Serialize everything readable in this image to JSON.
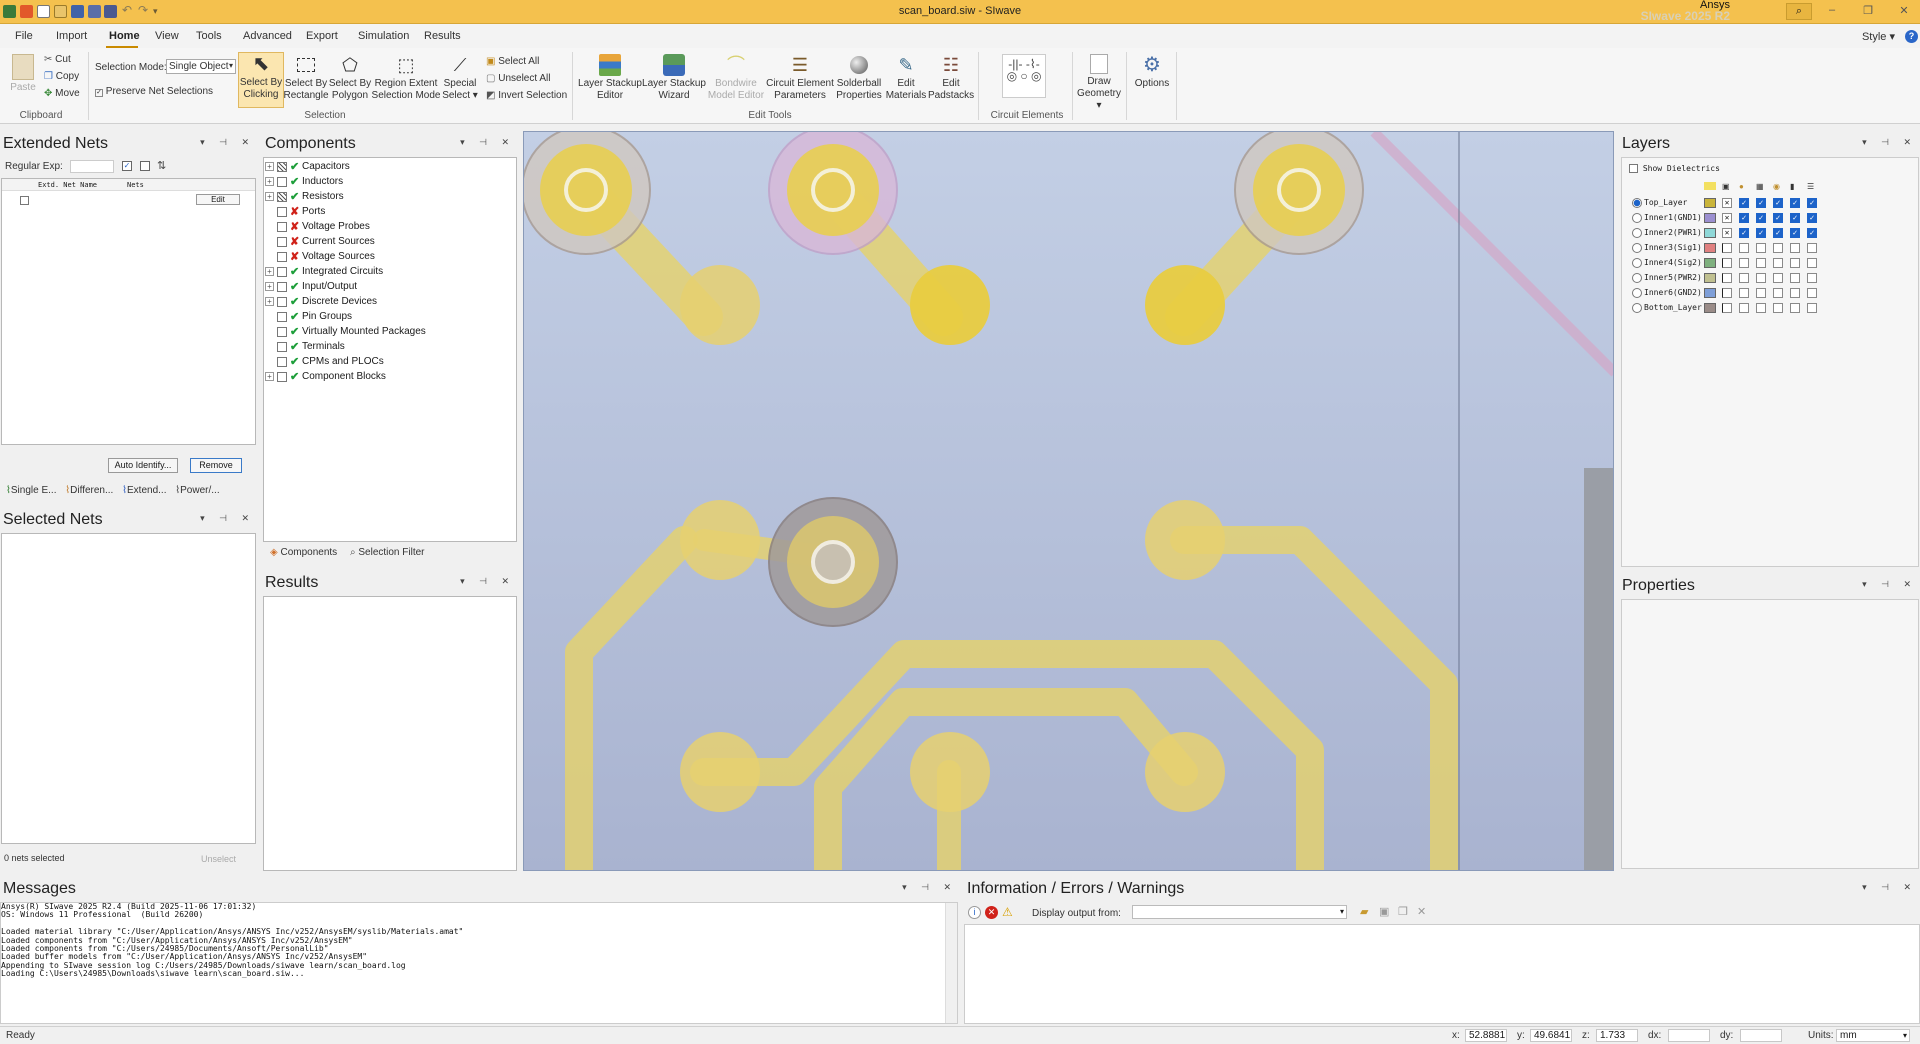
{
  "titlebar": {
    "title": "scan_board.siw - SIwave",
    "brand_top": "Ansys",
    "brand_bottom": "SIwave 2025 R2",
    "search_glyph": "⌕",
    "minimize": "–",
    "restore": "❐",
    "close": "✕"
  },
  "menu": {
    "items": [
      "File",
      "Import",
      "Home",
      "View",
      "Tools",
      "Advanced",
      "Export",
      "Simulation",
      "Results"
    ],
    "active": "Home",
    "style": "Style ▾"
  },
  "ribbon": {
    "clipboard": {
      "paste": "Paste",
      "cut": "Cut",
      "copy": "Copy",
      "move": "Move",
      "group": "Clipboard"
    },
    "selection_mode_label": "Selection Mode:",
    "selection_mode_value": "Single Object",
    "preserve_net": "Preserve Net Selections",
    "select_by_clicking": [
      "Select By",
      "Clicking"
    ],
    "select_by_rectangle": [
      "Select By",
      "Rectangle"
    ],
    "select_by_polygon": [
      "Select By",
      "Polygon"
    ],
    "region_extent": [
      "Region Extent",
      "Selection Mode"
    ],
    "special_select": [
      "Special",
      "Select ▾"
    ],
    "select_all": "Select All",
    "unselect_all": "Unselect All",
    "invert_selection": "Invert Selection",
    "selection_group": "Selection",
    "layer_stackup_editor": [
      "Layer Stackup",
      "Editor"
    ],
    "layer_stackup_wizard": [
      "Layer Stackup",
      "Wizard"
    ],
    "bondwire_model_editor": [
      "Bondwire",
      "Model Editor"
    ],
    "circuit_element_parameters": [
      "Circuit Element",
      "Parameters"
    ],
    "solderball_properties": [
      "Solderball",
      "Properties"
    ],
    "edit_materials": [
      "Edit",
      "Materials"
    ],
    "edit_padstacks": [
      "Edit",
      "Padstacks"
    ],
    "edit_tools_group": "Edit Tools",
    "circuit_elements_group": "Circuit Elements",
    "draw_geometry": [
      "Draw",
      "Geometry ▾"
    ],
    "options": "Options"
  },
  "extended_nets": {
    "title": "Extended Nets",
    "regexp_label": "Regular Exp:",
    "col1": "Extd. Net Name",
    "col2": "Nets",
    "edit": "Edit",
    "auto_identify": "Auto Identify...",
    "remove": "Remove",
    "tabs": [
      "Single E...",
      "Differen...",
      "Extend...",
      "Power/..."
    ]
  },
  "selected_nets": {
    "title": "Selected Nets",
    "count": "0 nets selected",
    "unselect": "Unselect"
  },
  "components": {
    "title": "Components",
    "items": [
      {
        "label": "Capacitors",
        "status": "mixed",
        "expand": true
      },
      {
        "label": "Inductors",
        "status": "ok",
        "expand": true
      },
      {
        "label": "Resistors",
        "status": "mixed",
        "expand": true
      },
      {
        "label": "Ports",
        "status": "bad",
        "expand": false
      },
      {
        "label": "Voltage Probes",
        "status": "bad",
        "expand": false
      },
      {
        "label": "Current Sources",
        "status": "bad",
        "expand": false
      },
      {
        "label": "Voltage Sources",
        "status": "bad",
        "expand": false
      },
      {
        "label": "Integrated Circuits",
        "status": "ok",
        "expand": true
      },
      {
        "label": "Input/Output",
        "status": "ok",
        "expand": true
      },
      {
        "label": "Discrete Devices",
        "status": "ok",
        "expand": true
      },
      {
        "label": "Pin Groups",
        "status": "ok",
        "expand": false
      },
      {
        "label": "Virtually Mounted Packages",
        "status": "ok",
        "expand": false
      },
      {
        "label": "Terminals",
        "status": "ok",
        "expand": false
      },
      {
        "label": "CPMs and PLOCs",
        "status": "ok",
        "expand": false
      },
      {
        "label": "Component Blocks",
        "status": "ok",
        "expand": true
      }
    ],
    "tabs": [
      "Components",
      "Selection Filter"
    ]
  },
  "results": {
    "title": "Results"
  },
  "layers": {
    "title": "Layers",
    "show_dielectrics": "Show Dielectrics",
    "rows": [
      {
        "name": "Top_Layer",
        "color": "#c9b43a",
        "selected": true,
        "on": true
      },
      {
        "name": "Inner1(GND1)",
        "color": "#9b8fd0",
        "selected": false,
        "on": true
      },
      {
        "name": "Inner2(PWR1)",
        "color": "#8fd8d8",
        "selected": false,
        "on": true
      },
      {
        "name": "Inner3(Sig1)",
        "color": "#e08080",
        "selected": false,
        "on": false
      },
      {
        "name": "Inner4(Sig2)",
        "color": "#7fb07f",
        "selected": false,
        "on": false
      },
      {
        "name": "Inner5(PWR2)",
        "color": "#c0c090",
        "selected": false,
        "on": false
      },
      {
        "name": "Inner6(GND2)",
        "color": "#7f9fd8",
        "selected": false,
        "on": false
      },
      {
        "name": "Bottom_Layer",
        "color": "#9a8c88",
        "selected": false,
        "on": false
      }
    ]
  },
  "properties": {
    "title": "Properties"
  },
  "messages": {
    "title": "Messages",
    "lines": [
      "Ansys(R) SIwave 2025 R2.4 (Build 2025-11-06 17:01:32)",
      "OS: Windows 11 Professional  (Build 26200)",
      "",
      "Loaded material library \"C:/User/Application/Ansys/ANSYS Inc/v252/AnsysEM/syslib/Materials.amat\"",
      "Loaded components from \"C:/User/Application/Ansys/ANSYS Inc/v252/AnsysEM\"",
      "Loaded components from \"C:/Users/24985/Documents/Ansoft/PersonalLib\"",
      "Loaded buffer models from \"C:/User/Application/Ansys/ANSYS Inc/v252/AnsysEM\"",
      "Appending to SIwave session log C:/Users/24985/Downloads/siwave learn/scan_board.log",
      "Loading C:\\Users\\24985\\Downloads\\siwave learn\\scan_board.siw..."
    ]
  },
  "info": {
    "title": "Information / Errors / Warnings",
    "display_output": "Display output from:"
  },
  "status": {
    "ready": "Ready",
    "x_label": "x:",
    "x": "52.8881",
    "y_label": "y:",
    "y": "49.6841",
    "z_label": "z:",
    "z": "1.733",
    "dx_label": "dx:",
    "dy_label": "dy:",
    "units_label": "Units:",
    "units": "mm"
  },
  "panel_buttons": "▾ ⊣ ✕"
}
